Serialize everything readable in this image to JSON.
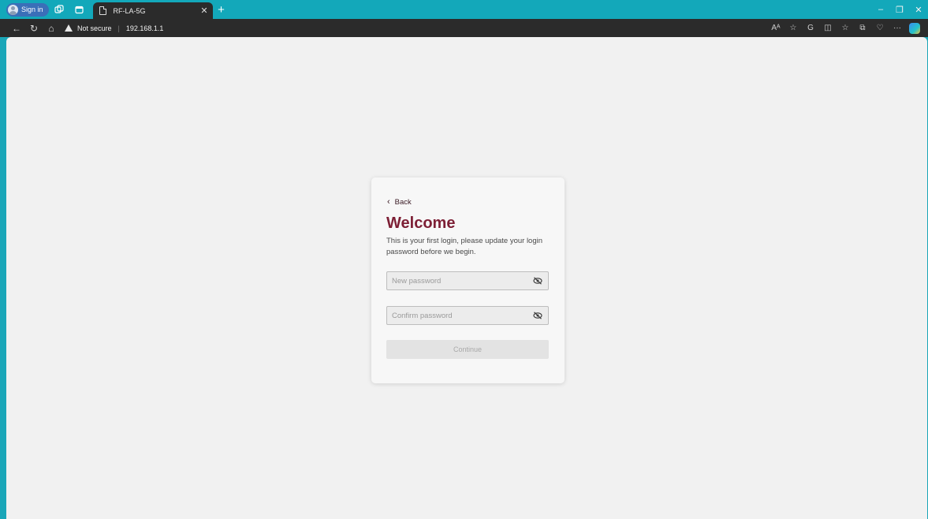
{
  "browser": {
    "profile_label": "Sign in",
    "tab_title": "RF-LA-5G",
    "security_label": "Not secure",
    "url": "192.168.1.1"
  },
  "login": {
    "back_label": "Back",
    "title": "Welcome",
    "intro": "This is your first login, please update your login password before we begin.",
    "new_password_placeholder": "New password",
    "confirm_password_placeholder": "Confirm password",
    "continue_label": "Continue"
  },
  "colors": {
    "accent": "#7d1f35",
    "titlebar": "#13a8ba",
    "toolbar": "#2b2b2b"
  }
}
